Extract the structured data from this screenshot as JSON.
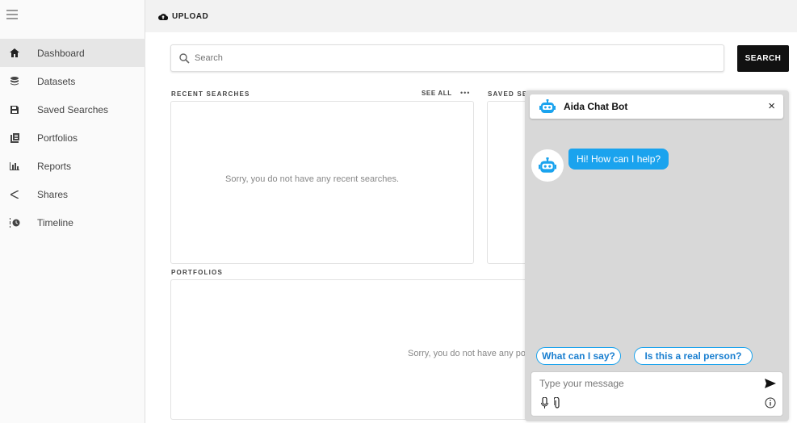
{
  "topbar": {
    "upload_label": "UPLOAD"
  },
  "sidebar": {
    "items": [
      {
        "label": "Dashboard",
        "icon": "home-icon"
      },
      {
        "label": "Datasets",
        "icon": "database-icon"
      },
      {
        "label": "Saved Searches",
        "icon": "save-icon"
      },
      {
        "label": "Portfolios",
        "icon": "portfolio-icon"
      },
      {
        "label": "Reports",
        "icon": "bar-chart-icon"
      },
      {
        "label": "Shares",
        "icon": "share-icon"
      },
      {
        "label": "Timeline",
        "icon": "timeline-icon"
      }
    ]
  },
  "search": {
    "placeholder": "Search",
    "button_label": "SEARCH"
  },
  "recent_searches": {
    "label": "RECENT SEARCHES",
    "see_all": "SEE ALL",
    "more": "•••",
    "empty": "Sorry, you do not have any recent searches."
  },
  "saved_searches": {
    "label": "SAVED SE"
  },
  "portfolios": {
    "label": "PORTFOLIOS",
    "empty": "Sorry, you do not have any por"
  },
  "chat": {
    "title": "Aida Chat Bot",
    "close": "×",
    "message": "Hi! How can I help?",
    "chips": [
      "What can I say?",
      "Is this a real person?"
    ],
    "input_placeholder": "Type your message"
  },
  "colors": {
    "accent": "#1aa3ee",
    "search_button": "#111111",
    "chat_bg": "#d8d8d8"
  }
}
